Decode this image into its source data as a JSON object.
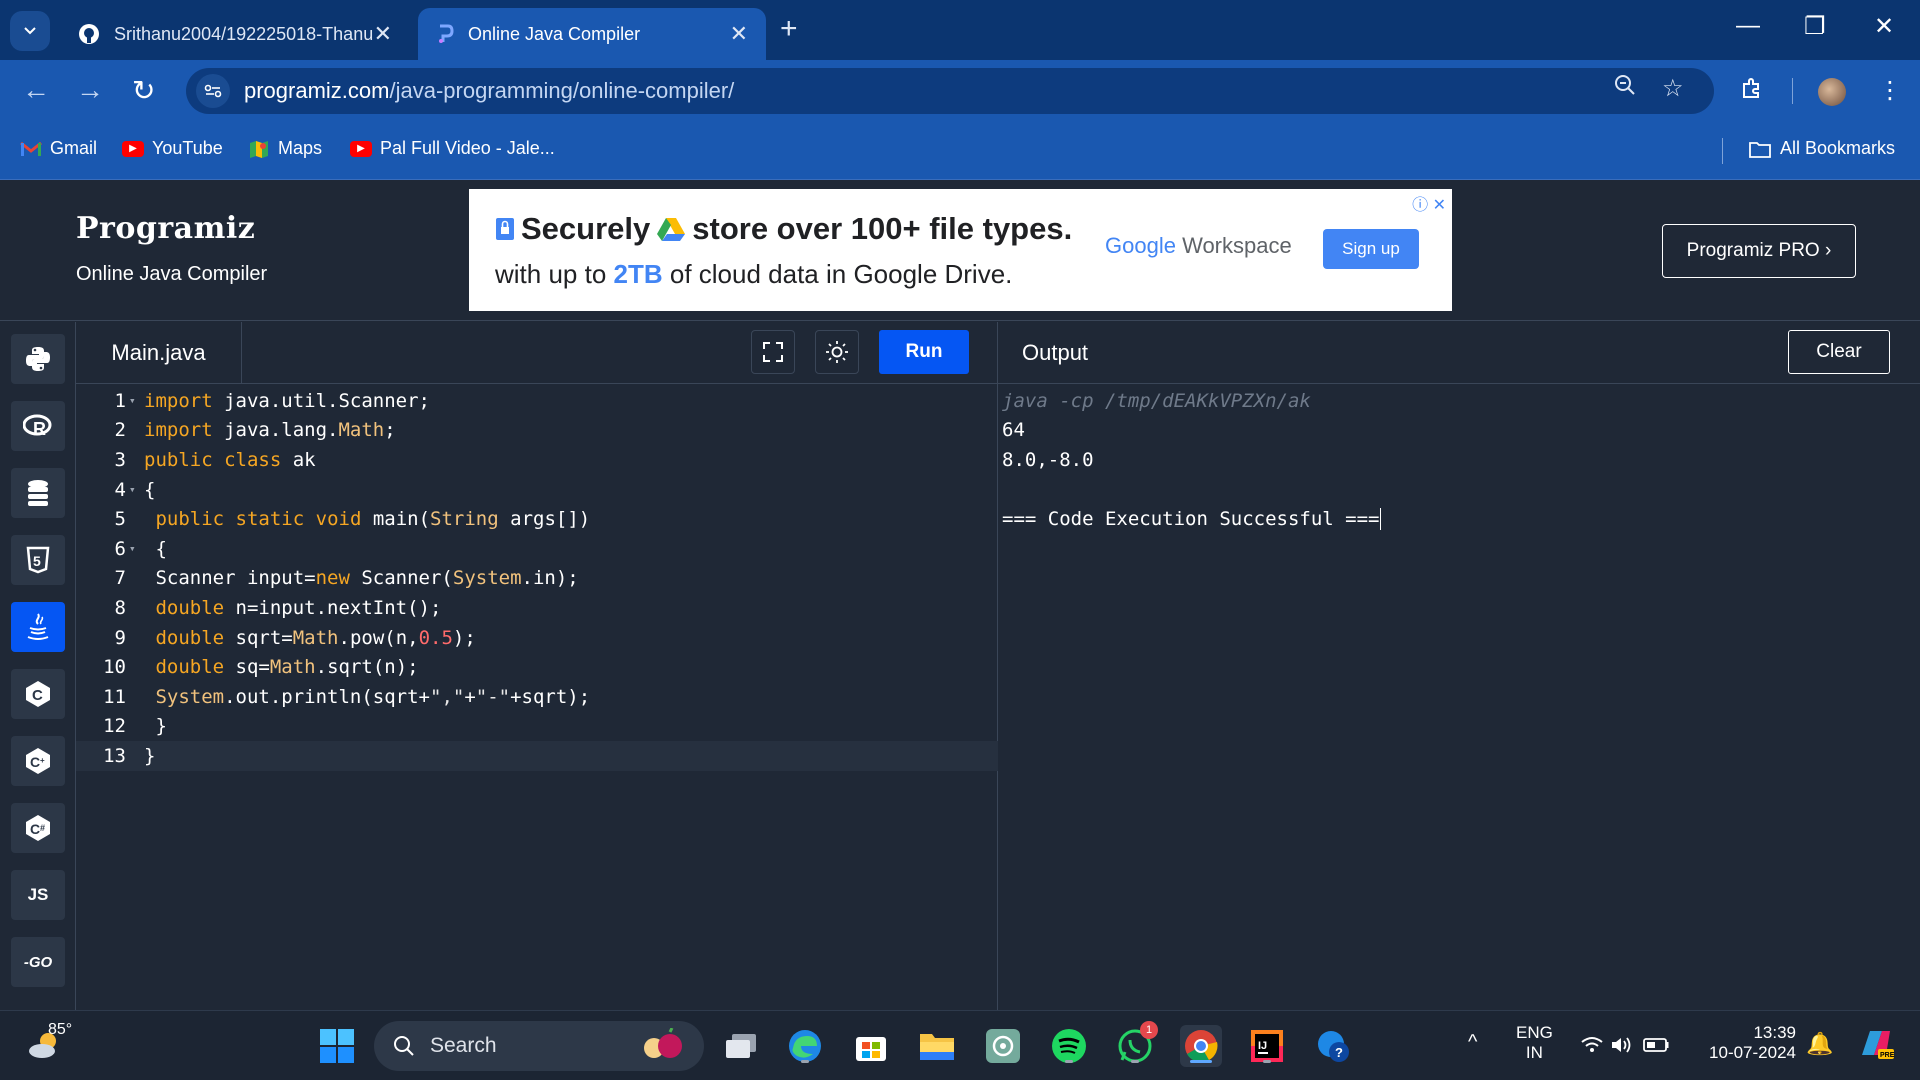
{
  "browser": {
    "tabs": [
      {
        "title": "Srithanu2004/192225018-Thanu",
        "active": false,
        "icon": "github-icon"
      },
      {
        "title": "Online Java Compiler",
        "active": true,
        "icon": "programiz-icon"
      }
    ],
    "url_host": "programiz.com",
    "url_path": "/java-programming/online-compiler/",
    "bookmarks": [
      {
        "label": "Gmail",
        "icon": "gmail-icon",
        "color": "#ea4335"
      },
      {
        "label": "YouTube",
        "icon": "youtube-icon",
        "color": "#ff0000"
      },
      {
        "label": "Maps",
        "icon": "maps-icon",
        "color": "#34a853"
      },
      {
        "label": "Pal Full Video - Jale...",
        "icon": "youtube-icon",
        "color": "#ff0000"
      }
    ],
    "all_bookmarks_label": "All Bookmarks"
  },
  "site": {
    "logo": "Programiz",
    "subtitle": "Online Java Compiler",
    "pro_button": "Programiz PRO ›"
  },
  "ad": {
    "line1_a": "Securely",
    "line1_b": "store over 100+ file types.",
    "line2_a": "with up to ",
    "line2_hl": "2TB",
    "line2_b": " of cloud data in Google Drive.",
    "brand_google": "Google",
    "brand_rest": "Workspace",
    "cta": "Sign up"
  },
  "rail": {
    "languages": [
      {
        "name": "python",
        "glyph": "🐍",
        "active": false
      },
      {
        "name": "r",
        "glyph": "R",
        "active": false
      },
      {
        "name": "sql",
        "glyph": "≣",
        "active": false
      },
      {
        "name": "html",
        "glyph": "5",
        "active": false
      },
      {
        "name": "java",
        "glyph": "♨",
        "active": true
      },
      {
        "name": "c",
        "glyph": "C",
        "active": false
      },
      {
        "name": "cpp",
        "glyph": "C",
        "active": false
      },
      {
        "name": "csharp",
        "glyph": "C",
        "active": false
      },
      {
        "name": "js",
        "glyph": "JS",
        "active": false
      },
      {
        "name": "go",
        "glyph": "-GO",
        "active": false
      }
    ]
  },
  "editor": {
    "filename": "Main.java",
    "run_label": "Run",
    "lines": [
      {
        "n": "1",
        "fold": true,
        "tokens": [
          [
            "kw",
            "import"
          ],
          [
            "txt",
            " java.util.Scanner;"
          ]
        ]
      },
      {
        "n": "2",
        "fold": false,
        "tokens": [
          [
            "kw",
            "import"
          ],
          [
            "txt",
            " java.lang."
          ],
          [
            "ty",
            "Math"
          ],
          [
            "txt",
            ";"
          ]
        ]
      },
      {
        "n": "3",
        "fold": false,
        "tokens": [
          [
            "kw",
            "public"
          ],
          [
            "txt",
            " "
          ],
          [
            "kw",
            "class"
          ],
          [
            "txt",
            " ak"
          ]
        ]
      },
      {
        "n": "4",
        "fold": true,
        "tokens": [
          [
            "txt",
            "{"
          ]
        ]
      },
      {
        "n": "5",
        "fold": false,
        "tokens": [
          [
            "txt",
            " "
          ],
          [
            "kw",
            "public"
          ],
          [
            "txt",
            " "
          ],
          [
            "kw",
            "static"
          ],
          [
            "txt",
            " "
          ],
          [
            "kw",
            "void"
          ],
          [
            "txt",
            " main("
          ],
          [
            "ty",
            "String"
          ],
          [
            "txt",
            " args[])"
          ]
        ]
      },
      {
        "n": "6",
        "fold": true,
        "tokens": [
          [
            "txt",
            " {"
          ]
        ]
      },
      {
        "n": "7",
        "fold": false,
        "tokens": [
          [
            "txt",
            " Scanner input="
          ],
          [
            "kw",
            "new"
          ],
          [
            "txt",
            " Scanner("
          ],
          [
            "ty",
            "System"
          ],
          [
            "txt",
            ".in);"
          ]
        ]
      },
      {
        "n": "8",
        "fold": false,
        "tokens": [
          [
            "txt",
            " "
          ],
          [
            "kw",
            "double"
          ],
          [
            "txt",
            " n=input.nextInt();"
          ]
        ]
      },
      {
        "n": "9",
        "fold": false,
        "tokens": [
          [
            "txt",
            " "
          ],
          [
            "kw",
            "double"
          ],
          [
            "txt",
            " sqrt="
          ],
          [
            "ty",
            "Math"
          ],
          [
            "txt",
            ".pow(n,"
          ],
          [
            "num",
            "0.5"
          ],
          [
            "txt",
            ");"
          ]
        ]
      },
      {
        "n": "10",
        "fold": false,
        "tokens": [
          [
            "txt",
            " "
          ],
          [
            "kw",
            "double"
          ],
          [
            "txt",
            " sq="
          ],
          [
            "ty",
            "Math"
          ],
          [
            "txt",
            ".sqrt(n);"
          ]
        ]
      },
      {
        "n": "11",
        "fold": false,
        "tokens": [
          [
            "txt",
            " "
          ],
          [
            "ty",
            "System"
          ],
          [
            "txt",
            ".out.println(sqrt+"
          ],
          [
            "str",
            "\",\""
          ],
          [
            "txt",
            "+"
          ],
          [
            "str",
            "\"-\""
          ],
          [
            "txt",
            "+sqrt);"
          ]
        ]
      },
      {
        "n": "12",
        "fold": false,
        "tokens": [
          [
            "txt",
            " }"
          ]
        ]
      },
      {
        "n": "13",
        "fold": false,
        "tokens": [
          [
            "txt",
            "}"
          ]
        ],
        "current": true
      }
    ]
  },
  "output": {
    "title": "Output",
    "clear_label": "Clear",
    "command": "java -cp /tmp/dEAKkVPZXn/ak",
    "lines": [
      "64",
      "8.0,-8.0",
      "",
      "=== Code Execution Successful ==="
    ]
  },
  "taskbar": {
    "temperature": "85°",
    "search_label": "Search",
    "whatsapp_badge": "1",
    "lang_top": "ENG",
    "lang_bottom": "IN",
    "time": "13:39",
    "date": "10-07-2024"
  }
}
